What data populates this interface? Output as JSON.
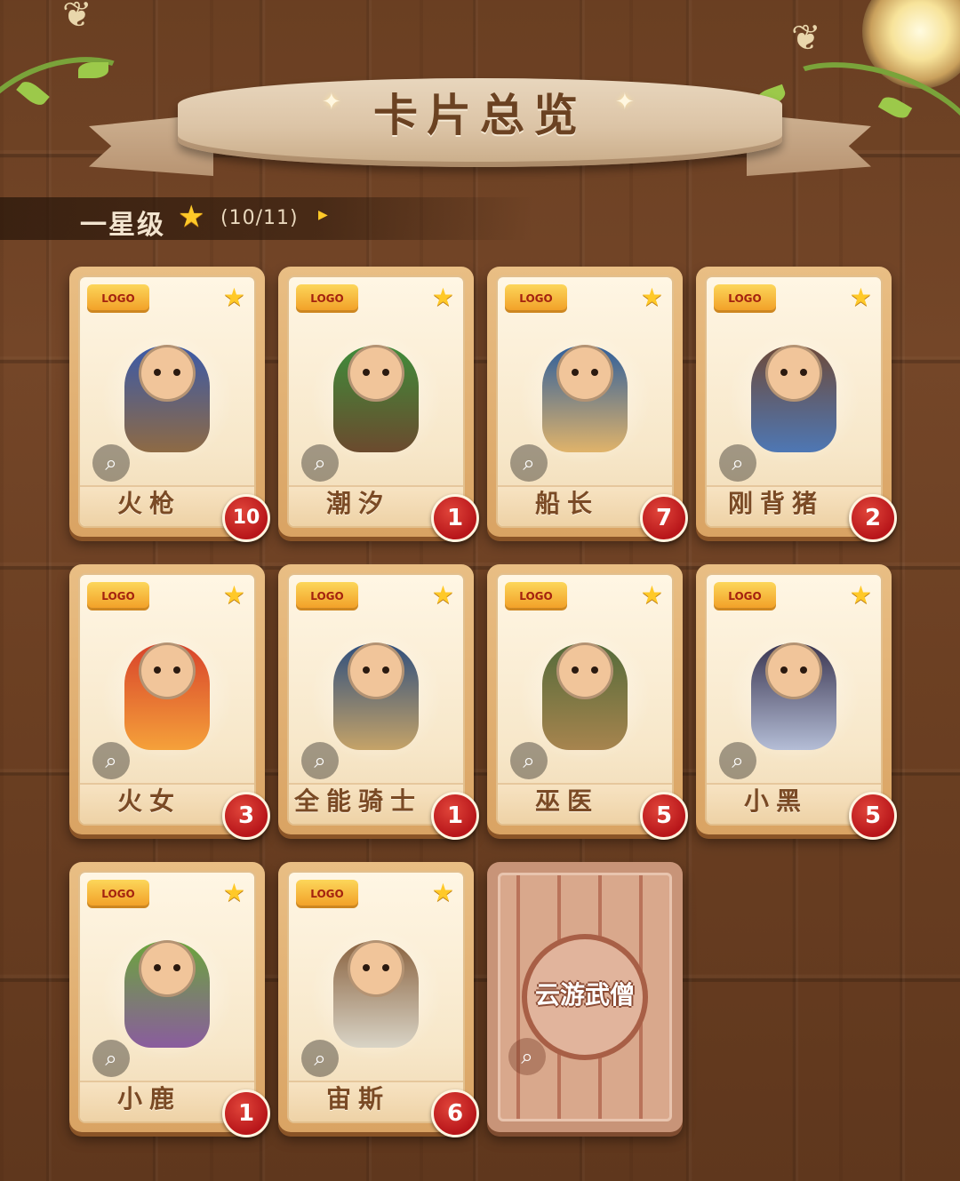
{
  "header": {
    "title": "卡片总览"
  },
  "rank": {
    "label": "一星级",
    "star_icon": "star-icon",
    "count": "(10/11)",
    "arrow_icon": "play-arrow-icon"
  },
  "colors": {
    "badge": "#c61f1f",
    "star": "#ffc928",
    "card_frame": "#e2b072",
    "name_text": "#7a4a25"
  },
  "cards": [
    {
      "name": "火枪",
      "count": "10",
      "art_colors": [
        "#3b5aa8",
        "#8e6a44"
      ]
    },
    {
      "name": "潮汐",
      "count": "1",
      "art_colors": [
        "#3f8c3a",
        "#6b4a2e"
      ]
    },
    {
      "name": "船长",
      "count": "7",
      "art_colors": [
        "#2f5f9c",
        "#e0b36a"
      ]
    },
    {
      "name": "刚背猪",
      "count": "2",
      "art_colors": [
        "#6d4a3a",
        "#4e77b4"
      ]
    },
    {
      "name": "火女",
      "count": "3",
      "art_colors": [
        "#d8432b",
        "#f5a13a"
      ]
    },
    {
      "name": "全能骑士",
      "count": "1",
      "art_colors": [
        "#2f4f7d",
        "#c5a368"
      ]
    },
    {
      "name": "巫医",
      "count": "5",
      "art_colors": [
        "#556b3a",
        "#a7844e"
      ]
    },
    {
      "name": "小黑",
      "count": "5",
      "art_colors": [
        "#3a3550",
        "#b4bdd6"
      ]
    },
    {
      "name": "小鹿",
      "count": "1",
      "art_colors": [
        "#6ba53c",
        "#8a5c9e"
      ]
    },
    {
      "name": "宙斯",
      "count": "6",
      "art_colors": [
        "#8a6340",
        "#d9d4c6"
      ]
    }
  ],
  "locked_card": {
    "name": "云游武僧"
  }
}
